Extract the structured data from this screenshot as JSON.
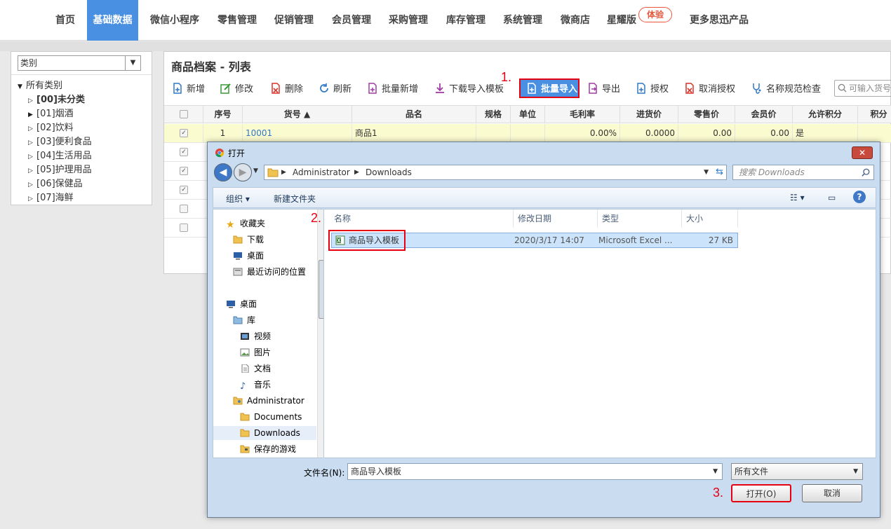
{
  "topnav": {
    "items": [
      "首页",
      "基础数据",
      "微信小程序",
      "零售管理",
      "促销管理",
      "会员管理",
      "采购管理",
      "库存管理",
      "系统管理",
      "微商店",
      "星耀版",
      "更多思迅产品"
    ],
    "badge": "体验",
    "active_color": "#4a90e2"
  },
  "category": {
    "select_value": "类别",
    "tree": [
      "所有类别",
      "[00]未分类",
      "[01]烟酒",
      "[02]饮料",
      "[03]便利食品",
      "[04]生活用品",
      "[05]护理用品",
      "[06]保健品",
      "[07]海鲜"
    ]
  },
  "main": {
    "title": "商品档案 - 列表",
    "toolbar": [
      "新增",
      "修改",
      "删除",
      "刷新",
      "批量新增",
      "下载导入模板",
      "批量导入",
      "导出",
      "授权",
      "取消授权",
      "名称规范检查"
    ],
    "search_placeholder": "可输入货号",
    "columns": [
      "序号",
      "货号 ▲",
      "品名",
      "规格",
      "单位",
      "毛利率",
      "进货价",
      "零售价",
      "会员价",
      "允许积分",
      "积分"
    ],
    "rows": [
      {
        "seq": "1",
        "code": "10001",
        "name": "商品1",
        "spec": "",
        "unit": "",
        "margin": "0.00%",
        "cost": "0.0000",
        "retail": "0.00",
        "member": "0.00",
        "points": "是"
      }
    ]
  },
  "annotations": [
    "1.",
    "2.",
    "3."
  ],
  "dialog": {
    "title": "打开",
    "path": [
      "Administrator",
      "Downloads"
    ],
    "search_placeholder": "搜索 Downloads",
    "commands": [
      "组织 ▾",
      "新建文件夹"
    ],
    "nav": [
      "收藏夹",
      "下载",
      "桌面",
      "最近访问的位置",
      "桌面",
      "库",
      "视频",
      "图片",
      "文档",
      "音乐",
      "Administrator",
      "Documents",
      "Downloads",
      "保存的游戏"
    ],
    "columns": [
      "名称",
      "修改日期",
      "类型",
      "大小"
    ],
    "file": {
      "name": "商品导入模板",
      "date": "2020/3/17 14:07",
      "type": "Microsoft Excel ...",
      "size": "27 KB"
    },
    "filename_label": "文件名(N):",
    "filename_value": "商品导入模板",
    "filetype_value": "所有文件",
    "open_label": "打开(O)",
    "cancel_label": "取消"
  }
}
